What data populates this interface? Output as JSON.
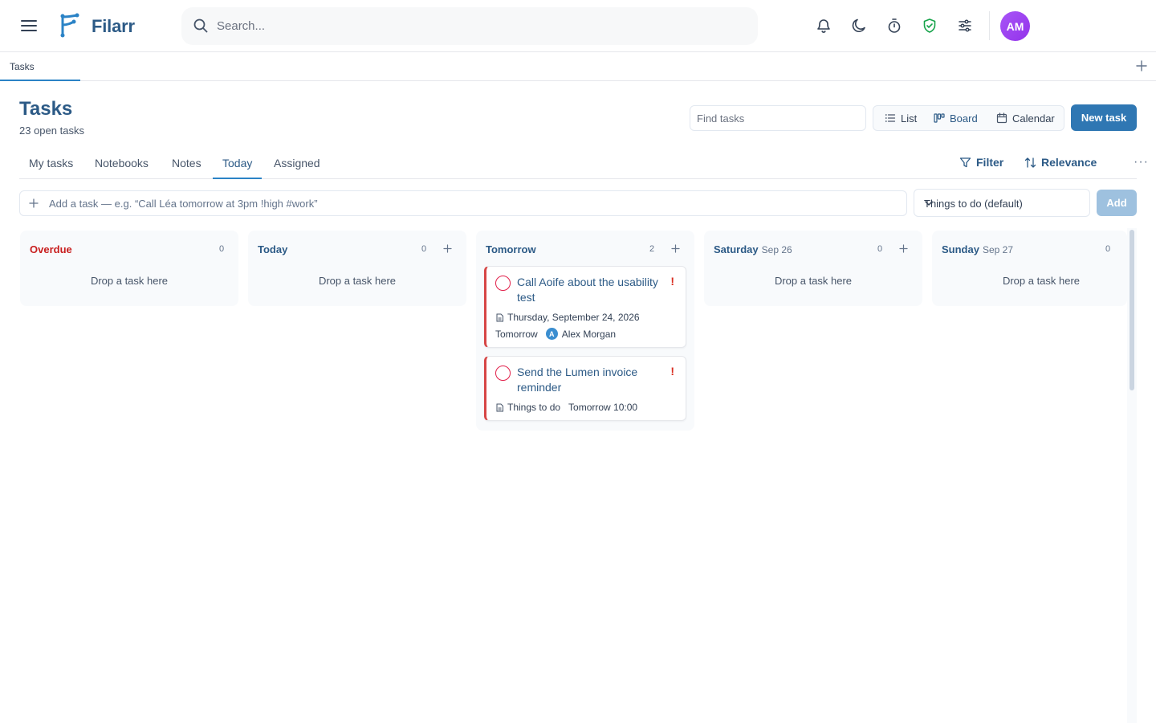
{
  "app": {
    "name": "Filarr",
    "search_placeholder": "Search...",
    "user_initials": "AM"
  },
  "tabs": {
    "active_tab": "Tasks"
  },
  "page": {
    "title": "Tasks",
    "subtitle": "23 open tasks",
    "find_placeholder": "Find tasks"
  },
  "views": {
    "list": "List",
    "board": "Board",
    "calendar": "Calendar",
    "active": "Board"
  },
  "new_task_label": "New task",
  "subtabs": [
    "My tasks",
    "Notebooks",
    "Notes",
    "Today",
    "Assigned"
  ],
  "active_subtab": "Today",
  "toolbar": {
    "filter": "Filter",
    "sort": "Relevance",
    "more": "···"
  },
  "quick_add": {
    "placeholder": "Add a task — e.g. “Call Léa tomorrow at 3pm !high #work”",
    "list_value": "Things to do (default)",
    "add_label": "Add"
  },
  "colors": {
    "accent": "#2f77b3",
    "overdue": "#c81e1e",
    "priority": "#d92d20",
    "avatar": "#a855f7"
  },
  "board": {
    "drop_text": "Drop a task here",
    "columns": [
      {
        "title": "Overdue",
        "date": "",
        "count": "0"
      },
      {
        "title": "Today",
        "date": "",
        "count": "0"
      },
      {
        "title": "Tomorrow",
        "date": "",
        "count": "2"
      },
      {
        "title": "Saturday",
        "date": "Sep 26",
        "count": "0"
      },
      {
        "title": "Sunday",
        "date": "Sep 27",
        "count": "0"
      }
    ],
    "cards": [
      {
        "title": "Call Aoife about the usability test",
        "priority": "!",
        "due": "Thursday, September 24, 2026",
        "when": "Tomorrow",
        "assignee_initial": "A",
        "assignee": "Alex Morgan"
      },
      {
        "title": "Send the Lumen invoice reminder",
        "priority": "!",
        "list": "Things to do",
        "when": "Tomorrow 10:00"
      }
    ]
  }
}
